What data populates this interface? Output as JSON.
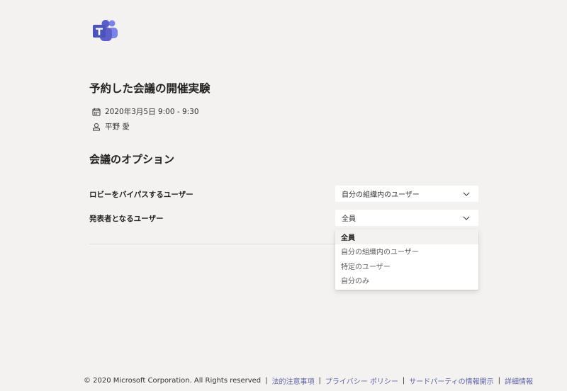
{
  "meeting": {
    "title": "予約した会議の開催実験",
    "datetime": "2020年3月5日 9:00 - 9:30",
    "organizer": "平野 愛"
  },
  "options": {
    "title": "会議のオプション",
    "lobby_bypass": {
      "label": "ロビーをバイパスするユーザー",
      "value": "自分の組織内のユーザー"
    },
    "presenters": {
      "label": "発表者となるユーザー",
      "value": "全員",
      "options": [
        "全員",
        "自分の組織内のユーザー",
        "特定のユーザー",
        "自分のみ"
      ]
    }
  },
  "footer": {
    "copyright": "© 2020 Microsoft Corporation. All Rights reserved",
    "links": [
      "法的注意事項",
      "プライバシー ポリシー",
      "サードパーティの情報開示",
      "詳細情報"
    ]
  },
  "icons": {
    "logo": "teams-logo-icon",
    "calendar": "calendar-icon",
    "person": "person-icon",
    "chevron": "chevron-down-icon"
  },
  "colors": {
    "brand": "#5b5fc7",
    "link": "#6264a7",
    "background": "#f3f2f1"
  }
}
